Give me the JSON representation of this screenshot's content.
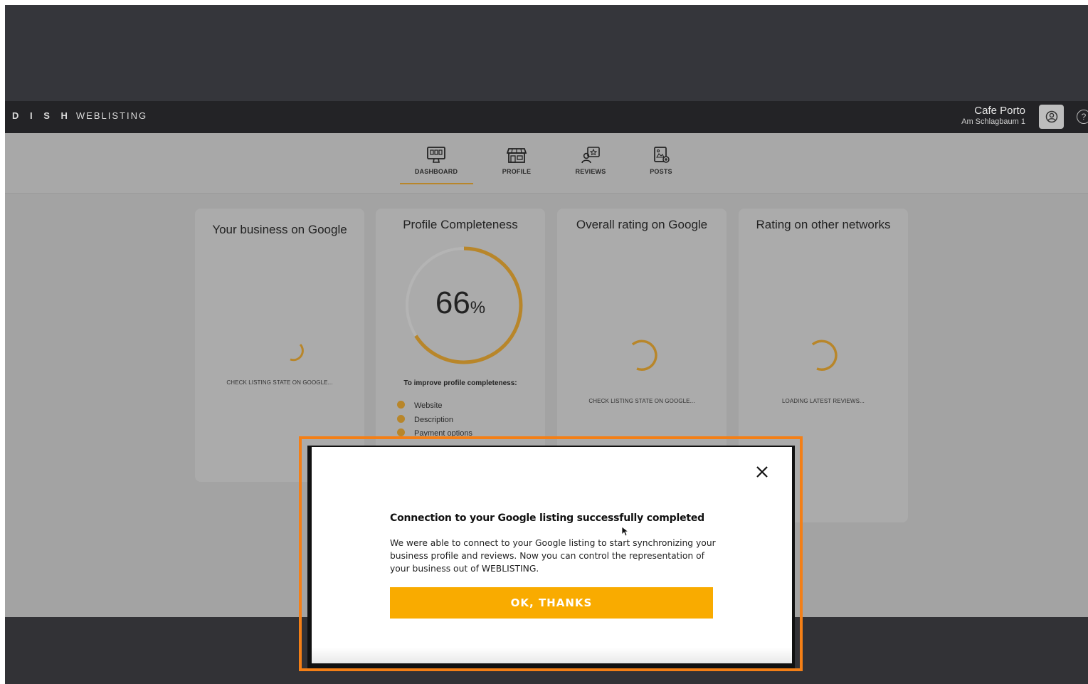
{
  "header": {
    "brand_bold": "D I S H",
    "brand_light": "WEBLISTING",
    "business_name": "Cafe Porto",
    "business_address": "Am Schlagbaum 1",
    "help_symbol": "?"
  },
  "nav": {
    "items": [
      {
        "label": "DASHBOARD",
        "icon": "monitor-icon",
        "active": true
      },
      {
        "label": "PROFILE",
        "icon": "storefront-icon",
        "active": false
      },
      {
        "label": "REVIEWS",
        "icon": "reviews-star-icon",
        "active": false
      },
      {
        "label": "POSTS",
        "icon": "post-image-icon",
        "active": false
      }
    ]
  },
  "cards": {
    "google_business": {
      "title": "Your business on Google",
      "status": "CHECK LISTING STATE ON GOOGLE..."
    },
    "completeness": {
      "title": "Profile Completeness",
      "value": "66",
      "unit": "%",
      "progress_fraction": 0.66,
      "improve_title": "To improve profile completeness:",
      "items": [
        "Website",
        "Description",
        "Payment options"
      ]
    },
    "overall_rating": {
      "title": "Overall rating on Google",
      "status": "CHECK LISTING STATE ON GOOGLE..."
    },
    "other_networks": {
      "title": "Rating on other networks",
      "status": "LOADING LATEST REVIEWS..."
    }
  },
  "modal": {
    "title": "Connection to your Google listing successfully completed",
    "body": "We were able to connect to your Google listing to start synchronizing your business profile and reviews. Now you can control the representation of your business out of WEBLISTING.",
    "button_label": "OK, THANKS",
    "close_symbol": "×"
  },
  "colors": {
    "accent": "#f9ab00",
    "gold": "#b8862a",
    "highlight": "#f47f16",
    "topbar": "#232326"
  }
}
